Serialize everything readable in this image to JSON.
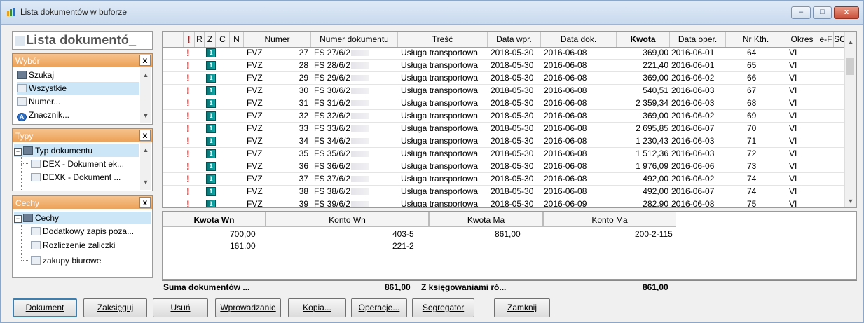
{
  "window": {
    "title": "Lista dokumentów w buforze",
    "controls": {
      "minimize": "–",
      "maximize": "□",
      "close": "x"
    }
  },
  "left_panel": {
    "header": "Lista dokumentó_",
    "wybor": {
      "title": "Wybór",
      "close": "x",
      "items": [
        "Szukaj",
        "Wszystkie",
        "Numer...",
        "Znacznik..."
      ],
      "selected": "Wszystkie"
    },
    "typy": {
      "title": "Typy",
      "close": "x",
      "root": "Typ dokumentu",
      "items": [
        "DEX - Dokument ek...",
        "DEXK - Dokument ..."
      ]
    },
    "cechy": {
      "title": "Cechy",
      "close": "x",
      "root": "Cechy",
      "items": [
        "Dodatkowy zapis poza...",
        "Rozliczenie zaliczki",
        "zakupy biurowe"
      ]
    }
  },
  "grid": {
    "columns": [
      "!",
      "R",
      "Z",
      "C",
      "N",
      "Numer",
      "Numer dokumentu",
      "Treść",
      "Data wpr.",
      "Data dok.",
      "Kwota",
      "Data oper.",
      "Nr Kth.",
      "Okres",
      "e-F",
      "SC"
    ],
    "rows": [
      {
        "excl": "!",
        "z": "1",
        "numer_pre": "FVZ",
        "numer": "27",
        "dok": "FS 27/6/2",
        "tresc": "Usługa transportowa",
        "data_wpr": "2018-05-30",
        "data_dok": "2016-06-08",
        "kwota": "369,00",
        "data_oper": "2016-06-01",
        "nr_kth": "64",
        "okres": "VI"
      },
      {
        "excl": "!",
        "z": "1",
        "numer_pre": "FVZ",
        "numer": "28",
        "dok": "FS 28/6/2",
        "tresc": "Usługa transportowa",
        "data_wpr": "2018-05-30",
        "data_dok": "2016-06-08",
        "kwota": "221,40",
        "data_oper": "2016-06-01",
        "nr_kth": "65",
        "okres": "VI"
      },
      {
        "excl": "!",
        "z": "1",
        "numer_pre": "FVZ",
        "numer": "29",
        "dok": "FS 29/6/2",
        "tresc": "Usługa transportowa",
        "data_wpr": "2018-05-30",
        "data_dok": "2016-06-08",
        "kwota": "369,00",
        "data_oper": "2016-06-02",
        "nr_kth": "66",
        "okres": "VI"
      },
      {
        "excl": "!",
        "z": "1",
        "numer_pre": "FVZ",
        "numer": "30",
        "dok": "FS 30/6/2",
        "tresc": "Usługa transportowa",
        "data_wpr": "2018-05-30",
        "data_dok": "2016-06-08",
        "kwota": "540,51",
        "data_oper": "2016-06-03",
        "nr_kth": "67",
        "okres": "VI"
      },
      {
        "excl": "!",
        "z": "1",
        "numer_pre": "FVZ",
        "numer": "31",
        "dok": "FS 31/6/2",
        "tresc": "Usługa transportowa",
        "data_wpr": "2018-05-30",
        "data_dok": "2016-06-08",
        "kwota": "2 359,34",
        "data_oper": "2016-06-03",
        "nr_kth": "68",
        "okres": "VI"
      },
      {
        "excl": "!",
        "z": "1",
        "numer_pre": "FVZ",
        "numer": "32",
        "dok": "FS 32/6/2",
        "tresc": "Usługa transportowa",
        "data_wpr": "2018-05-30",
        "data_dok": "2016-06-08",
        "kwota": "369,00",
        "data_oper": "2016-06-02",
        "nr_kth": "69",
        "okres": "VI"
      },
      {
        "excl": "!",
        "z": "1",
        "numer_pre": "FVZ",
        "numer": "33",
        "dok": "FS 33/6/2",
        "tresc": "Usługa transportowa",
        "data_wpr": "2018-05-30",
        "data_dok": "2016-06-08",
        "kwota": "2 695,85",
        "data_oper": "2016-06-07",
        "nr_kth": "70",
        "okres": "VI"
      },
      {
        "excl": "!",
        "z": "1",
        "numer_pre": "FVZ",
        "numer": "34",
        "dok": "FS 34/6/2",
        "tresc": "Usługa transportowa",
        "data_wpr": "2018-05-30",
        "data_dok": "2016-06-08",
        "kwota": "1 230,43",
        "data_oper": "2016-06-03",
        "nr_kth": "71",
        "okres": "VI"
      },
      {
        "excl": "!",
        "z": "1",
        "numer_pre": "FVZ",
        "numer": "35",
        "dok": "FS 35/6/2",
        "tresc": "Usługa transportowa",
        "data_wpr": "2018-05-30",
        "data_dok": "2016-06-08",
        "kwota": "1 512,36",
        "data_oper": "2016-06-03",
        "nr_kth": "72",
        "okres": "VI"
      },
      {
        "excl": "!",
        "z": "1",
        "numer_pre": "FVZ",
        "numer": "36",
        "dok": "FS 36/6/2",
        "tresc": "Usługa transportowa",
        "data_wpr": "2018-05-30",
        "data_dok": "2016-06-08",
        "kwota": "1 976,09",
        "data_oper": "2016-06-06",
        "nr_kth": "73",
        "okres": "VI"
      },
      {
        "excl": "!",
        "z": "1",
        "numer_pre": "FVZ",
        "numer": "37",
        "dok": "FS 37/6/2",
        "tresc": "Usługa transportowa",
        "data_wpr": "2018-05-30",
        "data_dok": "2016-06-08",
        "kwota": "492,00",
        "data_oper": "2016-06-02",
        "nr_kth": "74",
        "okres": "VI"
      },
      {
        "excl": "!",
        "z": "1",
        "numer_pre": "FVZ",
        "numer": "38",
        "dok": "FS 38/6/2",
        "tresc": "Usługa transportowa",
        "data_wpr": "2018-05-30",
        "data_dok": "2016-06-08",
        "kwota": "492,00",
        "data_oper": "2016-06-07",
        "nr_kth": "74",
        "okres": "VI"
      },
      {
        "excl": "!",
        "z": "1",
        "numer_pre": "FVZ",
        "numer": "39",
        "dok": "FS 39/6/2",
        "tresc": "Usługa transportowa",
        "data_wpr": "2018-05-30",
        "data_dok": "2016-06-09",
        "kwota": "282,90",
        "data_oper": "2016-06-08",
        "nr_kth": "75",
        "okres": "VI"
      }
    ]
  },
  "postings": {
    "columns": [
      "Kwota Wn",
      "Konto Wn",
      "Kwota Ma",
      "Konto Ma"
    ],
    "rows": [
      {
        "kwota_wn": "700,00",
        "konto_wn": "403-5",
        "kwota_ma": "861,00",
        "konto_ma": "200-2-115"
      },
      {
        "kwota_wn": "161,00",
        "konto_wn": "221-2",
        "kwota_ma": "",
        "konto_ma": ""
      }
    ]
  },
  "summary": {
    "label": "Suma dokumentów ...",
    "value": "861,00",
    "label2": "Z księgowaniami ró...",
    "value2": "861,00"
  },
  "buttons": [
    "Dokument",
    "Zaksięguj",
    "Usuń",
    "Wprowadzanie",
    "Kopia...",
    "Operacje...",
    "Segregator",
    "Zamknij"
  ]
}
